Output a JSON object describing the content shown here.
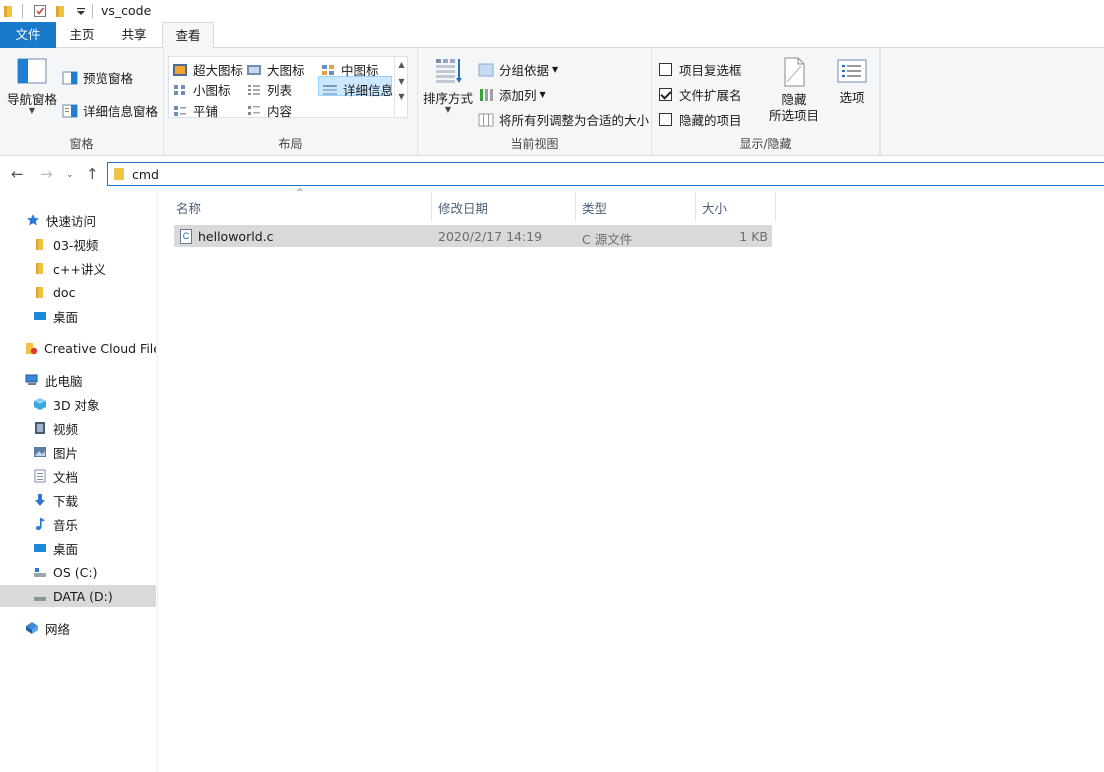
{
  "window": {
    "title": "vs_code"
  },
  "tabs": [
    {
      "label": "文件"
    },
    {
      "label": "主页"
    },
    {
      "label": "共享"
    },
    {
      "label": "查看"
    }
  ],
  "ribbon": {
    "panes": {
      "label": "窗格",
      "nav_pane": "导航窗格",
      "preview_pane": "预览窗格",
      "details_pane": "详细信息窗格"
    },
    "layout": {
      "label": "布局",
      "extra_large": "超大图标",
      "large": "大图标",
      "medium": "中图标",
      "small": "小图标",
      "list": "列表",
      "details": "详细信息",
      "tiles": "平铺",
      "content": "内容"
    },
    "current_view": {
      "label": "当前视图",
      "sort_by": "排序方式",
      "group_by": "分组依据",
      "add_columns": "添加列",
      "size_all_columns": "将所有列调整为合适的大小"
    },
    "show_hide": {
      "label": "显示/隐藏",
      "item_checkboxes": "项目复选框",
      "file_extensions": "文件扩展名",
      "hidden_items": "隐藏的项目",
      "hide_selected_line1": "隐藏",
      "hide_selected_line2": "所选项目",
      "options": "选项",
      "checked": {
        "item_checkboxes": false,
        "file_extensions": true,
        "hidden_items": false
      }
    }
  },
  "address": {
    "path": "cmd"
  },
  "nav_pane": {
    "items": [
      {
        "label": "快速访问"
      },
      {
        "label": "03-视频"
      },
      {
        "label": "c++讲义"
      },
      {
        "label": "doc"
      },
      {
        "label": "桌面"
      },
      {
        "label": "Creative Cloud Files"
      },
      {
        "label": "此电脑"
      },
      {
        "label": "3D 对象"
      },
      {
        "label": "视频"
      },
      {
        "label": "图片"
      },
      {
        "label": "文档"
      },
      {
        "label": "下载"
      },
      {
        "label": "音乐"
      },
      {
        "label": "桌面"
      },
      {
        "label": "OS (C:)"
      },
      {
        "label": "DATA (D:)"
      },
      {
        "label": "网络"
      }
    ]
  },
  "file_list": {
    "columns": {
      "name": "名称",
      "modified": "修改日期",
      "type": "类型",
      "size": "大小"
    },
    "rows": [
      {
        "name": "helloworld.c",
        "modified": "2020/2/17 14:19",
        "type": "C 源文件",
        "size": "1 KB",
        "icon": "c-file-icon"
      }
    ]
  },
  "colors": {
    "accent": "#1979ca",
    "selection": "#d9d9d9",
    "header_text": "#4c607a"
  }
}
